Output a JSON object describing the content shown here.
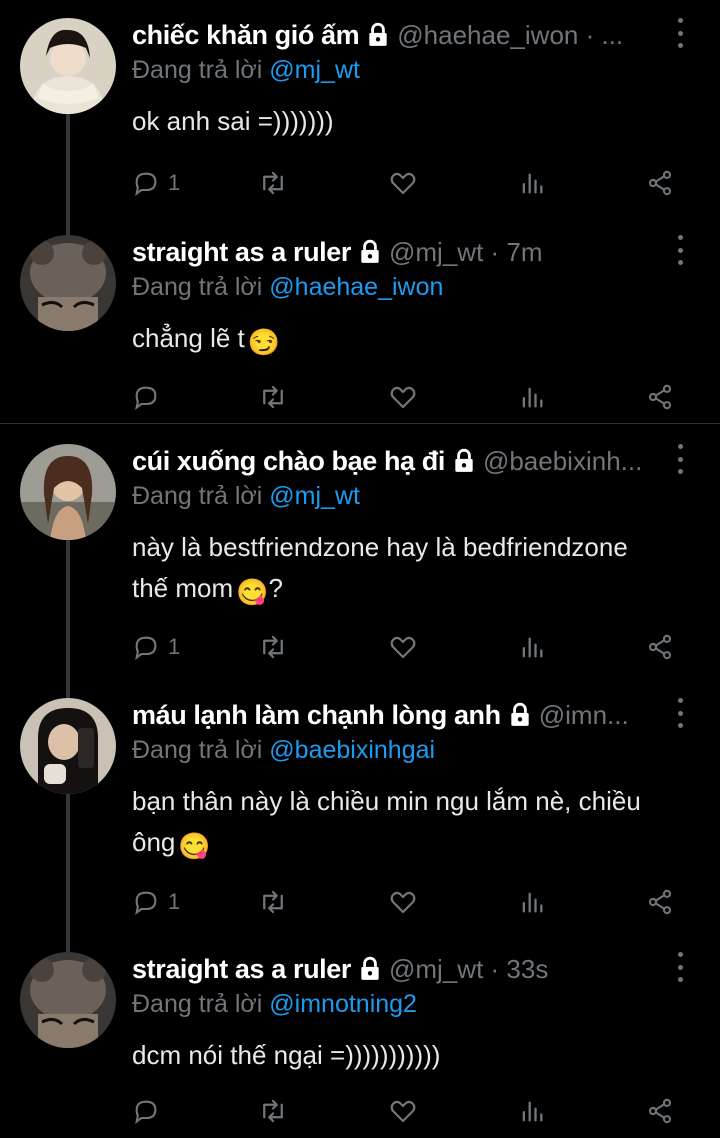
{
  "tweets": [
    {
      "name": "chiếc khăn gió ấm",
      "handle": "@haehae_iwon · ...",
      "reply_prefix": "Đang trả lời ",
      "reply_to": "@mj_wt",
      "text_lines": [
        "ok anh sai =)))))))"
      ],
      "replies": "1",
      "avatar_color": "#c9c2b3"
    },
    {
      "name": "straight as a ruler",
      "handle": "@mj_wt · 7m",
      "reply_prefix": "Đang trả lời ",
      "reply_to": "@haehae_iwon",
      "text_lines": [
        "chẳng lẽ t"
      ],
      "emoji": "😏",
      "replies": "",
      "avatar_color": "#5b5550"
    },
    {
      "name": "cúi xuống chào bạe hạ đi",
      "handle": "@baebixinh...",
      "reply_prefix": "Đang trả lời ",
      "reply_to": "@mj_wt",
      "text_lines": [
        "này là bestfriendzone hay là bedfriendzone",
        "thế mom"
      ],
      "emoji": "😋",
      "emoji_after": "?",
      "replies": "1",
      "avatar_color": "#a58f7a"
    },
    {
      "name": "máu lạnh làm chạnh lòng anh",
      "handle": "@imn...",
      "reply_prefix": "Đang trả lời ",
      "reply_to": "@baebixinhgai",
      "text_lines": [
        "bạn thân này là chiều min ngu lắm nè, chiều",
        "ông"
      ],
      "emoji": "😋",
      "replies": "1",
      "avatar_color": "#2a2522"
    },
    {
      "name": "straight as a ruler",
      "handle": "@mj_wt · 33s",
      "reply_prefix": "Đang trả lời ",
      "reply_to": "@imnotning2",
      "text_lines": [
        "dcm nói thế ngại =)))))))))))"
      ],
      "replies": "",
      "avatar_color": "#5b5550"
    }
  ],
  "colors": {
    "background": "#000000",
    "text": "#e7e9ea",
    "secondary": "#71767b",
    "mention": "#1d9bf0",
    "divider": "#2f3336"
  },
  "icons": [
    "reply-icon",
    "retweet-icon",
    "like-icon",
    "views-icon",
    "share-icon",
    "lock-icon",
    "more-icon"
  ]
}
